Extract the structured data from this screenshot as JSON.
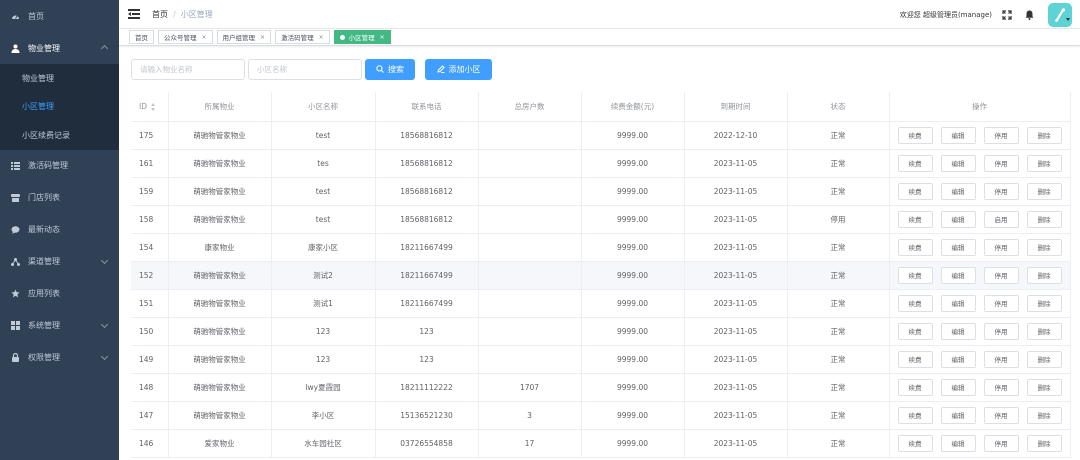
{
  "sidebar": {
    "items": [
      {
        "label": "首页",
        "icon": "dashboard-icon"
      },
      {
        "label": "物业管理",
        "icon": "user-icon",
        "open": true,
        "children": [
          {
            "label": "物业管理"
          },
          {
            "label": "小区管理",
            "active": true
          },
          {
            "label": "小区续费记录"
          }
        ]
      },
      {
        "label": "激活码管理",
        "icon": "list-icon"
      },
      {
        "label": "门店列表",
        "icon": "store-icon"
      },
      {
        "label": "最新动态",
        "icon": "message-icon"
      },
      {
        "label": "渠道管理",
        "icon": "tree-icon",
        "has_children": true
      },
      {
        "label": "应用列表",
        "icon": "star-icon"
      },
      {
        "label": "系统管理",
        "icon": "grid-icon",
        "has_children": true
      },
      {
        "label": "权限管理",
        "icon": "lock-icon",
        "has_children": true
      }
    ]
  },
  "header": {
    "breadcrumb_home": "首页",
    "breadcrumb_sep": "/",
    "breadcrumb_current": "小区管理",
    "welcome": "欢迎您 超级管理员(manage)"
  },
  "tags": [
    {
      "label": "首页",
      "closable": false
    },
    {
      "label": "公众号管理",
      "closable": true
    },
    {
      "label": "用户组管理",
      "closable": true
    },
    {
      "label": "激活码管理",
      "closable": true
    },
    {
      "label": "小区管理",
      "closable": true,
      "active": true
    }
  ],
  "search": {
    "property_placeholder": "请输入物业名称",
    "community_placeholder": "小区名称",
    "search_label": "搜索",
    "add_label": "添加小区"
  },
  "table": {
    "headers": [
      "ID",
      "所属物业",
      "小区名称",
      "联系电话",
      "总房户数",
      "续费金额(元)",
      "到期时间",
      "状态",
      "操作"
    ],
    "actions": [
      "续费",
      "编辑",
      "停用",
      "删除"
    ],
    "rows": [
      {
        "id": "175",
        "property": "萌驰物管家物业",
        "name": "test",
        "phone": "18568816812",
        "households": "",
        "amount": "9999.00",
        "expire": "2022-12-10",
        "status": "正常",
        "toggle": "停用"
      },
      {
        "id": "161",
        "property": "萌驰物管家物业",
        "name": "tes",
        "phone": "18568816812",
        "households": "",
        "amount": "9999.00",
        "expire": "2023-11-05",
        "status": "正常",
        "toggle": "停用"
      },
      {
        "id": "159",
        "property": "萌驰物管家物业",
        "name": "test",
        "phone": "18568816812",
        "households": "",
        "amount": "9999.00",
        "expire": "2023-11-05",
        "status": "正常",
        "toggle": "停用"
      },
      {
        "id": "158",
        "property": "萌驰物管家物业",
        "name": "test",
        "phone": "18568816812",
        "households": "",
        "amount": "9999.00",
        "expire": "2023-11-05",
        "status": "停用",
        "toggle": "启用"
      },
      {
        "id": "154",
        "property": "康家物业",
        "name": "康家小区",
        "phone": "18211667499",
        "households": "",
        "amount": "9999.00",
        "expire": "2023-11-05",
        "status": "正常",
        "toggle": "停用"
      },
      {
        "id": "152",
        "property": "萌驰物管家物业",
        "name": "测试2",
        "phone": "18211667499",
        "households": "",
        "amount": "9999.00",
        "expire": "2023-11-05",
        "status": "正常",
        "toggle": "停用",
        "highlight": true
      },
      {
        "id": "151",
        "property": "萌驰物管家物业",
        "name": "测试1",
        "phone": "18211667499",
        "households": "",
        "amount": "9999.00",
        "expire": "2023-11-05",
        "status": "正常",
        "toggle": "停用"
      },
      {
        "id": "150",
        "property": "萌驰物管家物业",
        "name": "123",
        "phone": "123",
        "households": "",
        "amount": "9999.00",
        "expire": "2023-11-05",
        "status": "正常",
        "toggle": "停用"
      },
      {
        "id": "149",
        "property": "萌驰物管家物业",
        "name": "123",
        "phone": "123",
        "households": "",
        "amount": "9999.00",
        "expire": "2023-11-05",
        "status": "正常",
        "toggle": "停用"
      },
      {
        "id": "148",
        "property": "萌驰物管家物业",
        "name": "lwy夏霞园",
        "phone": "18211112222",
        "households": "1707",
        "amount": "9999.00",
        "expire": "2023-11-05",
        "status": "正常",
        "toggle": "停用"
      },
      {
        "id": "147",
        "property": "萌驰物管家物业",
        "name": "李小区",
        "phone": "15136521230",
        "households": "3",
        "amount": "9999.00",
        "expire": "2023-11-05",
        "status": "正常",
        "toggle": "停用"
      },
      {
        "id": "146",
        "property": "爱家物业",
        "name": "水车园社区",
        "phone": "03726554858",
        "households": "17",
        "amount": "9999.00",
        "expire": "2023-11-05",
        "status": "正常",
        "toggle": "停用"
      }
    ]
  },
  "colors": {
    "sidebar_bg": "#304156",
    "submenu_bg": "#1f2d3d",
    "primary": "#409eff",
    "active_tag": "#42b983",
    "avatar": "#5dd3d6"
  }
}
